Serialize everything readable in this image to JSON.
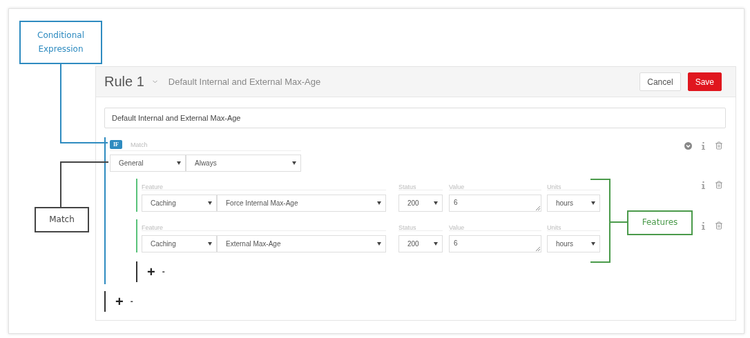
{
  "callouts": [
    {
      "kind": "conditional",
      "label": "Conditional Expression",
      "color": "#2e8bc0"
    },
    {
      "kind": "match",
      "label": "Match",
      "color": "#444444"
    },
    {
      "kind": "features",
      "label": "Features",
      "color": "#4a9a4a"
    }
  ],
  "rule": {
    "title": "Rule 1",
    "subtitle": "Default Internal and External Max-Age",
    "cancel": "Cancel",
    "save": "Save",
    "name_value": "Default Internal and External Max-Age"
  },
  "condition": {
    "badge": "IF",
    "label": "Match",
    "selects": [
      "General",
      "Always"
    ]
  },
  "features": [
    {
      "labels": [
        "Feature",
        "Status",
        "Value",
        "Units"
      ],
      "category": "Caching",
      "feature": "Force Internal Max-Age",
      "status": "200",
      "value": "6",
      "units": "hours"
    },
    {
      "labels": [
        "Feature",
        "Status",
        "Value",
        "Units"
      ],
      "category": "Caching",
      "feature": "External Max-Age",
      "status": "200",
      "value": "6",
      "units": "hours"
    }
  ],
  "inner_add": {
    "plus": "+",
    "minus": "-"
  },
  "outer_add": {
    "plus": "+",
    "minus": "-"
  }
}
